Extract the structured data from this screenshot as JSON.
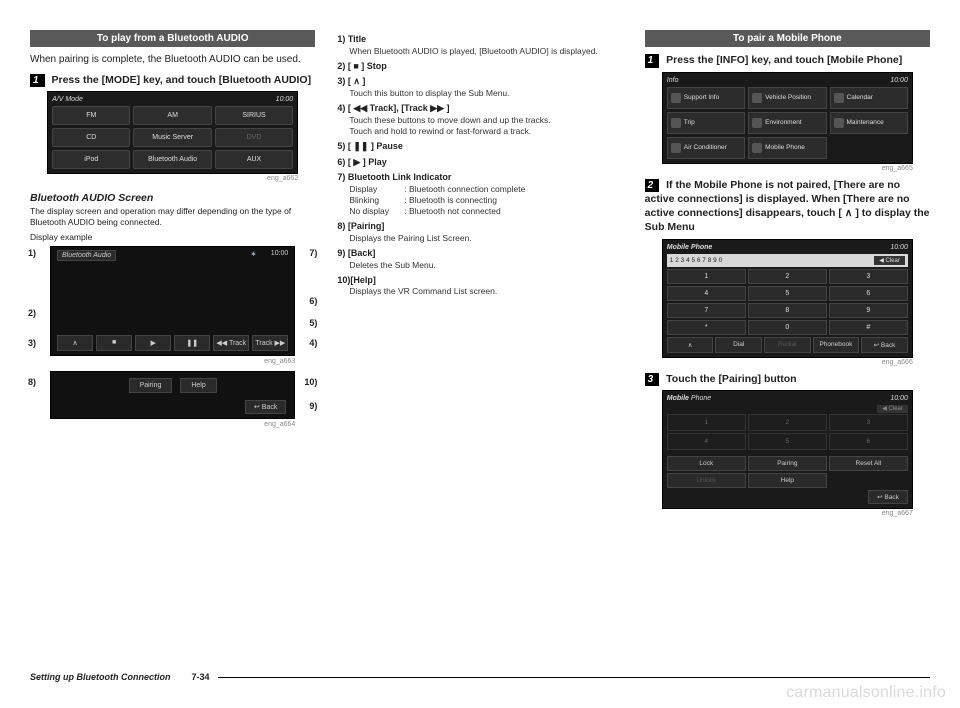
{
  "col1": {
    "heading": "To play from a Bluetooth AUDIO",
    "intro": "When pairing is complete, the Bluetooth AUDIO can be used.",
    "step1_num": "1",
    "step1": "Press the [MODE] key, and touch [Bluetooth AUDIO]",
    "mode_screen": {
      "title": "A/V Mode",
      "clock": "10:00",
      "buttons": [
        "FM",
        "AM",
        "SIRIUS",
        "CD",
        "Music Server",
        "DVD",
        "iPod",
        "Bluetooth Audio",
        "AUX"
      ],
      "dim_idx": [
        5
      ]
    },
    "cap1": "eng_a662",
    "sub1": "Bluetooth AUDIO Screen",
    "sub1_desc": "The display screen and operation may differ depending on the type of Bluetooth AUDIO being connected.",
    "disp_ex": "Display example",
    "fig1": {
      "title": "Bluetooth Audio",
      "clock": "10:00",
      "controls": [
        "∧",
        "■",
        "▶",
        "❚❚",
        "◀◀ Track",
        "Track ▶▶"
      ],
      "left": [
        "1)",
        "2)",
        "3)"
      ],
      "right": [
        "7)",
        "6)",
        "5)",
        "4)"
      ]
    },
    "cap2": "eng_a663",
    "fig2": {
      "btns": [
        "Pairing",
        "Help"
      ],
      "back": "Back",
      "left": [
        "8)"
      ],
      "right": [
        "10)",
        "9)"
      ]
    },
    "cap3": "eng_a664"
  },
  "col2": {
    "items": [
      {
        "n": "1)",
        "t": "Title",
        "d": [
          "When Bluetooth AUDIO is played, [Bluetooth AUDIO] is displayed."
        ]
      },
      {
        "n": "2)",
        "t": "[ ■ ] Stop"
      },
      {
        "n": "3)",
        "t": "[ ∧ ]",
        "d": [
          "Touch this button to display the Sub Menu."
        ]
      },
      {
        "n": "4)",
        "t": "[ ◀◀ Track], [Track ▶▶ ]",
        "d": [
          "Touch these buttons to move down and up the tracks.",
          "Touch and hold to rewind or fast-forward a track."
        ]
      },
      {
        "n": "5)",
        "t": "[ ❚❚ ] Pause"
      },
      {
        "n": "6)",
        "t": "[ ▶ ] Play"
      },
      {
        "n": "7)",
        "t": "Bluetooth Link Indicator",
        "pairs": [
          {
            "k": "Display",
            "v": ": Bluetooth connection complete"
          },
          {
            "k": "Blinking",
            "v": ": Bluetooth is connecting"
          },
          {
            "k": "No display",
            "v": ": Bluetooth not connected"
          }
        ]
      },
      {
        "n": "8)",
        "t": "[Pairing]",
        "d": [
          "Displays the Pairing List Screen."
        ]
      },
      {
        "n": "9)",
        "t": "[Back]",
        "d": [
          "Deletes the Sub Menu."
        ]
      },
      {
        "n": "10)",
        "t": "[Help]",
        "d": [
          "Displays the VR Command List screen."
        ],
        "nosplit": true
      }
    ]
  },
  "col3": {
    "heading": "To pair a Mobile Phone",
    "step1_num": "1",
    "step1": "Press the [INFO] key, and touch [Mobile Phone]",
    "info_screen": {
      "title": "Info",
      "clock": "10:00",
      "items": [
        "Support Info",
        "Vehicle Position",
        "Calendar",
        "Trip",
        "Environment",
        "Maintenance",
        "Air Conditioner",
        "Mobile Phone"
      ]
    },
    "cap1": "eng_a665",
    "step2_num": "2",
    "step2": "If the Mobile Phone is not paired, [There are no active connections] is displayed. When [There are no active connections] disappears, touch [ ∧ ] to display the Sub Menu",
    "keypad": {
      "title": "Mobile Phone",
      "clock": "10:00",
      "digits_bar": "1 2 3 4 5 6 7 8 9 0",
      "clear": "◀ Clear",
      "keys": [
        "1",
        "2",
        "3",
        "4",
        "5",
        "6",
        "7",
        "8",
        "9",
        "*",
        "0",
        "#"
      ],
      "row": [
        "∧",
        "Dial",
        "Redial",
        "Phonebook",
        "Back"
      ],
      "row_dim": [
        2
      ]
    },
    "cap2": "eng_a666",
    "step3_num": "3",
    "step3": "Touch the [Pairing] button",
    "mp_screen": {
      "title": "Mobile Phone",
      "clock": "10:00",
      "clear": "◀ Clear",
      "slots": [
        "1",
        "2",
        "3",
        "4",
        "5",
        "6"
      ],
      "row1": [
        "Lock",
        "Pairing",
        "Reset All"
      ],
      "row2": [
        "Unlock",
        "Help"
      ],
      "row2_dim": [
        0
      ],
      "back": "Back"
    },
    "cap3": "eng_a667"
  },
  "footer": {
    "section": "Setting up Bluetooth Connection",
    "page": "7-34"
  },
  "watermark": "carmanualsonline.info"
}
